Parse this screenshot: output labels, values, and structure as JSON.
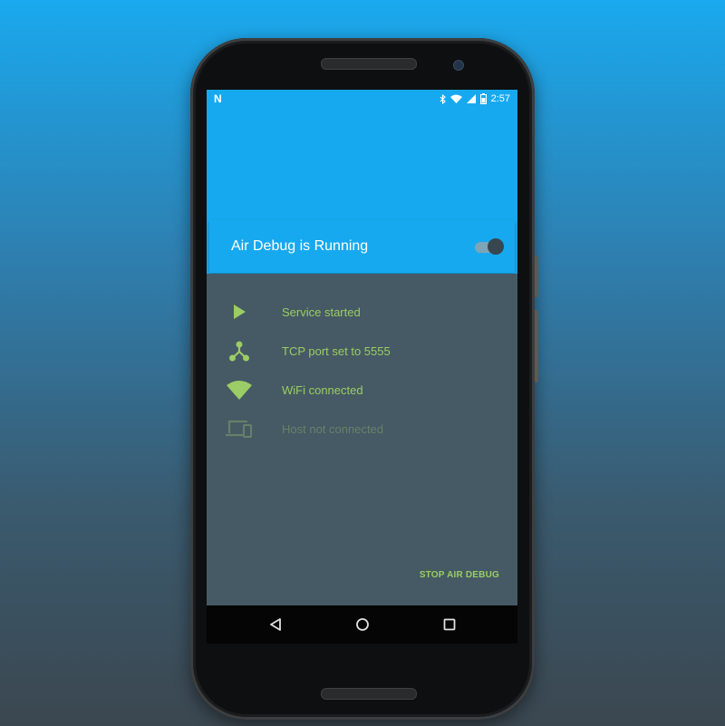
{
  "statusbar": {
    "notification_icon": "n-icon",
    "time": "2:57",
    "icons": [
      "bluetooth-icon",
      "wifi-icon",
      "signal-icon",
      "battery-icon"
    ]
  },
  "header": {
    "title": "Air Debug is Running",
    "toggle_on": true
  },
  "status_items": [
    {
      "icon": "play-icon",
      "label": "Service started",
      "active": true
    },
    {
      "icon": "network-icon",
      "label": "TCP port set to 5555",
      "active": true
    },
    {
      "icon": "wifi-icon",
      "label": "WiFi connected",
      "active": true
    },
    {
      "icon": "devices-icon",
      "label": "Host not connected",
      "active": false
    }
  ],
  "actions": {
    "stop_label": "STOP AIR DEBUG"
  },
  "navbar": {
    "buttons": [
      "back-icon",
      "home-icon",
      "recents-icon"
    ]
  },
  "colors": {
    "accent_blue": "#17a9ef",
    "panel": "#455a64",
    "status_green": "#9ccc65",
    "status_dim": "#66806a"
  }
}
